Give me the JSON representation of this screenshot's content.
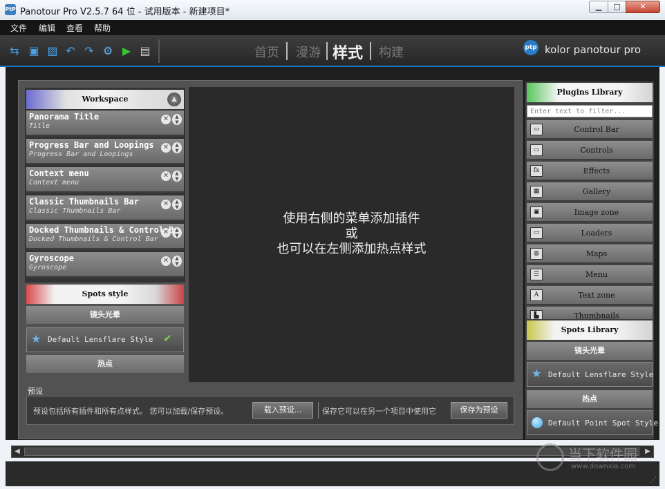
{
  "window": {
    "title": "Panotour Pro V2.5.7 64 位 - 试用版本 - 新建项目*",
    "icon_text": "PtP",
    "min": "▁",
    "max": "□",
    "close": "✕"
  },
  "menu": [
    "文件",
    "编辑",
    "查看",
    "帮助"
  ],
  "toolbar": {
    "icons": [
      "find-replace-icon",
      "save-icon",
      "add-image-icon",
      "undo-icon",
      "redo-icon",
      "settings-icon",
      "play-icon",
      "folder-icon"
    ],
    "tabs": [
      "首页",
      "漫游",
      "样式",
      "构建"
    ],
    "active_tab": "样式",
    "logo_badge": "ptp",
    "logo_text": "kolor panotour pro"
  },
  "workspace": {
    "header": "Workspace",
    "items": [
      {
        "title": "Panorama Title",
        "subtitle": "Title"
      },
      {
        "title": "Progress Bar and Loopings",
        "subtitle": "Progress Bar and Loopings"
      },
      {
        "title": "Context menu",
        "subtitle": "Context menu"
      },
      {
        "title": "Classic Thumbnails Bar",
        "subtitle": "Classic Thumbnails Bar"
      },
      {
        "title": "Docked Thumbnails & Control B",
        "subtitle": "Docked Thumbnails & Control Bar"
      },
      {
        "title": "Gyroscope",
        "subtitle": "Gyroscope"
      }
    ]
  },
  "spots_style": {
    "header": "Spots style",
    "lensflare_section": "镜头光晕",
    "lensflare_item": "Default Lensflare Style",
    "hotspot_section": "热点"
  },
  "canvas": {
    "line1": "使用右侧的菜单添加插件",
    "line2": "或",
    "line3": "也可以在左侧添加热点样式"
  },
  "preset": {
    "label": "预设",
    "text_left": "预设包括所有插件和所有点样式。 您可以加载/保存预设。",
    "load_button": "载入预设...",
    "text_right": "保存它可以在另一个项目中使用它",
    "save_button": "保存为预设"
  },
  "plugins_library": {
    "header": "Plugins Library",
    "filter_placeholder": "Enter text to filter...",
    "items": [
      {
        "label": "Control Bar",
        "icon": "▭"
      },
      {
        "label": "Controls",
        "icon": "▭"
      },
      {
        "label": "Effects",
        "icon": "fx"
      },
      {
        "label": "Gallery",
        "icon": "▦"
      },
      {
        "label": "Image zone",
        "icon": "▣"
      },
      {
        "label": "Loaders",
        "icon": "▭"
      },
      {
        "label": "Maps",
        "icon": "◍"
      },
      {
        "label": "Menu",
        "icon": "☰"
      },
      {
        "label": "Text zone",
        "icon": "A"
      },
      {
        "label": "Thumbnails",
        "icon": "▙"
      }
    ]
  },
  "spots_library": {
    "header": "Spots Library",
    "lensflare_section": "镜头光晕",
    "lensflare_item": "Default Lensflare Style",
    "hotspot_section": "热点",
    "point_item": "Default Point Spot Style"
  },
  "watermark": {
    "text": "当下软件园",
    "url": "www.downxia.com"
  }
}
